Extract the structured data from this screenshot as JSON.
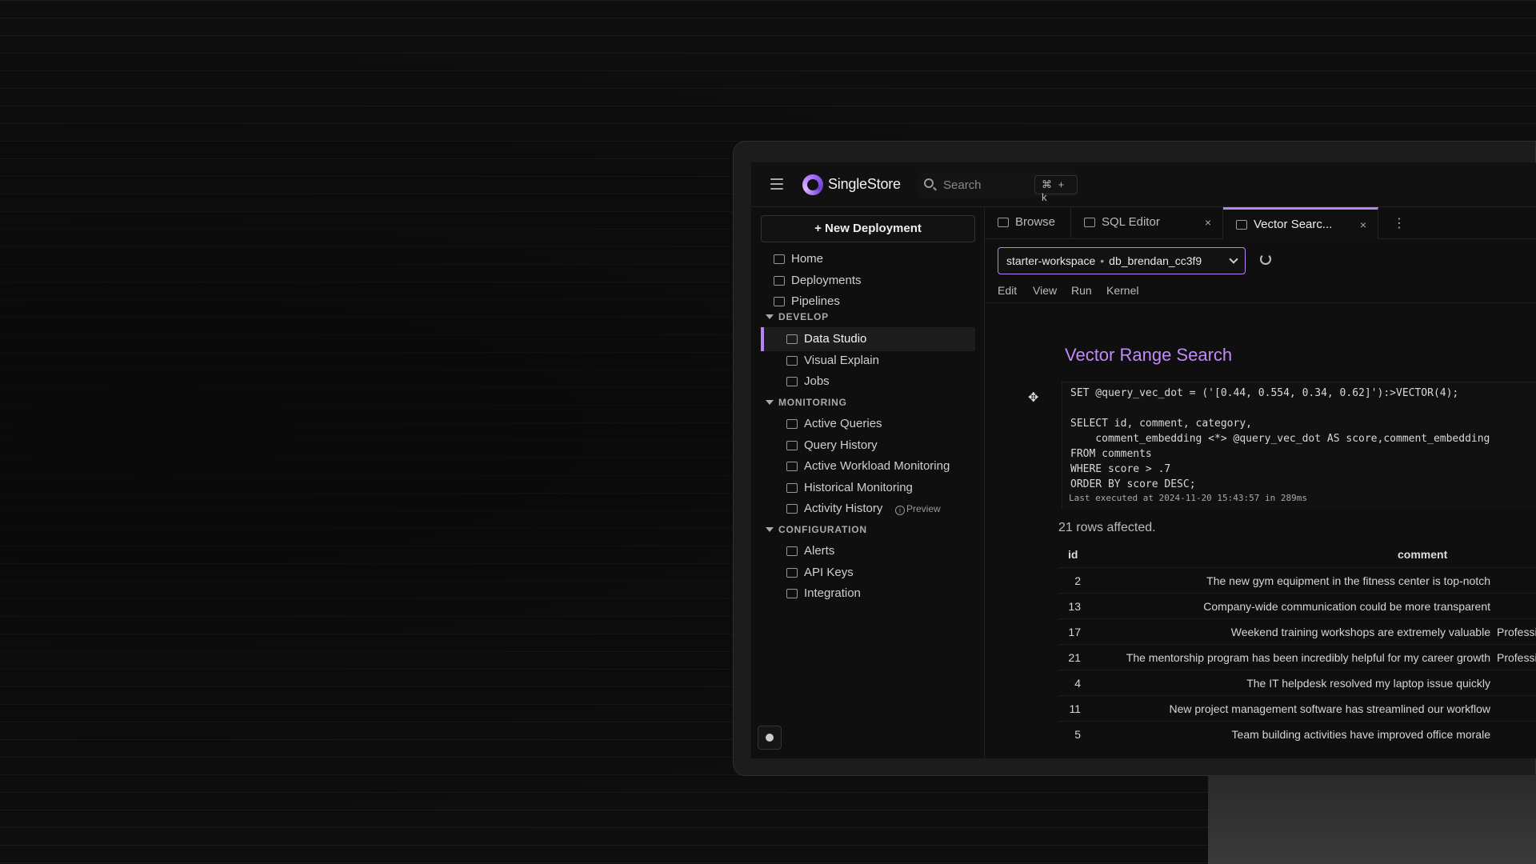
{
  "app": {
    "name": "SingleStore",
    "search_placeholder": "Search",
    "search_shortcut": "⌘ + k"
  },
  "sidebar": {
    "new_deployment": "New Deployment",
    "top_items": [
      "Home",
      "Deployments",
      "Pipelines"
    ],
    "sections": [
      {
        "title": "DEVELOP",
        "items": [
          "Data Studio",
          "Visual Explain",
          "Jobs"
        ]
      },
      {
        "title": "MONITORING",
        "items": [
          "Active Queries",
          "Query History",
          "Active Workload Monitoring",
          "Historical Monitoring",
          "Activity History"
        ]
      },
      {
        "title": "CONFIGURATION",
        "items": [
          "Alerts",
          "API Keys",
          "Integration"
        ]
      }
    ],
    "active_item": "Data Studio",
    "preview_badge": "Preview"
  },
  "tabs": [
    {
      "label": "Browse"
    },
    {
      "label": "SQL Editor",
      "close": "×"
    },
    {
      "label": "Vector Searc...",
      "close": "×"
    }
  ],
  "workspace": {
    "name": "starter-workspace",
    "separator": "•",
    "database": "db_brendan_cc3f9"
  },
  "menu": [
    "Edit",
    "View",
    "Run",
    "Kernel"
  ],
  "notebook": {
    "title": "Vector Range Search",
    "code_lines": [
      "SET @query_vec_dot = ('[0.44, 0.554, 0.34, 0.62]'):>VECTOR(4);",
      "",
      "SELECT id, comment, category,",
      "    comment_embedding <*> @query_vec_dot AS score,comment_embedding",
      "FROM comments",
      "WHERE score > .7",
      "ORDER BY score DESC;"
    ],
    "last_executed": "Last executed at 2024-11-20 15:43:57 in 289ms",
    "rows_affected": "21 rows affected.",
    "table": {
      "headers": [
        "id",
        "comment"
      ],
      "rows": [
        {
          "id": "2",
          "comment": "The new gym equipment in the fitness center is top-notch",
          "category": ""
        },
        {
          "id": "13",
          "comment": "Company-wide communication could be more transparent",
          "category": ""
        },
        {
          "id": "17",
          "comment": "Weekend training workshops are extremely valuable",
          "category": "Professio"
        },
        {
          "id": "21",
          "comment": "The mentorship program has been incredibly helpful for my career growth",
          "category": "Professio"
        },
        {
          "id": "4",
          "comment": "The IT helpdesk resolved my laptop issue quickly",
          "category": ""
        },
        {
          "id": "11",
          "comment": "New project management software has streamlined our workflow",
          "category": ""
        },
        {
          "id": "5",
          "comment": "Team building activities have improved office morale",
          "category": ""
        }
      ]
    }
  },
  "colors": {
    "accent": "#b784f5",
    "title": "#c08bf7",
    "background": "#0e0e0e"
  }
}
